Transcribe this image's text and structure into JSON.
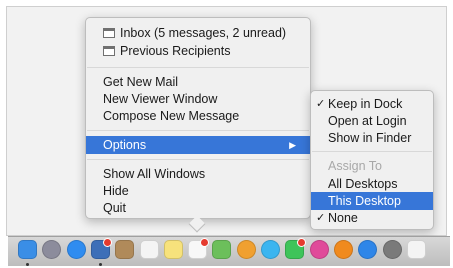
{
  "main_menu": {
    "windows": [
      {
        "label": "Inbox (5 messages, 2 unread)"
      },
      {
        "label": "Previous Recipients"
      }
    ],
    "actions": [
      "Get New Mail",
      "New Viewer Window",
      "Compose New Message"
    ],
    "options_label": "Options",
    "options_arrow": "▶",
    "window_actions": [
      "Show All Windows",
      "Hide",
      "Quit"
    ]
  },
  "options_menu": {
    "keep_in_dock": "Keep in Dock",
    "open_at_login": "Open at Login",
    "show_in_finder": "Show in Finder",
    "assign_to": "Assign To",
    "all_desktops": "All Desktops",
    "this_desktop": "This Desktop",
    "none": "None",
    "checkmark": "✓"
  },
  "dock": {
    "icons": [
      {
        "name": "finder-icon",
        "color": "#3a8ee6"
      },
      {
        "name": "launchpad-icon",
        "color": "#8c8c9c"
      },
      {
        "name": "safari-icon",
        "color": "#2f8cf0"
      },
      {
        "name": "mail-icon",
        "color": "#3d6fb8"
      },
      {
        "name": "contacts-icon",
        "color": "#b08a5a"
      },
      {
        "name": "calendar-icon",
        "color": "#f4f4f4"
      },
      {
        "name": "notes-icon",
        "color": "#f7e27c"
      },
      {
        "name": "reminders-icon",
        "color": "#f8f8f8"
      },
      {
        "name": "maps-icon",
        "color": "#6cbf5b"
      },
      {
        "name": "photos-icon",
        "color": "#f0a030"
      },
      {
        "name": "messages-icon",
        "color": "#3bb5f0"
      },
      {
        "name": "facetime-icon",
        "color": "#3ec45a"
      },
      {
        "name": "itunes-icon",
        "color": "#e04a9a"
      },
      {
        "name": "ibooks-icon",
        "color": "#f08a1e"
      },
      {
        "name": "app-store-icon",
        "color": "#2f86e8"
      },
      {
        "name": "system-preferences-icon",
        "color": "#7a7a7a"
      },
      {
        "name": "document-icon",
        "color": "#f4f4f4"
      }
    ]
  }
}
